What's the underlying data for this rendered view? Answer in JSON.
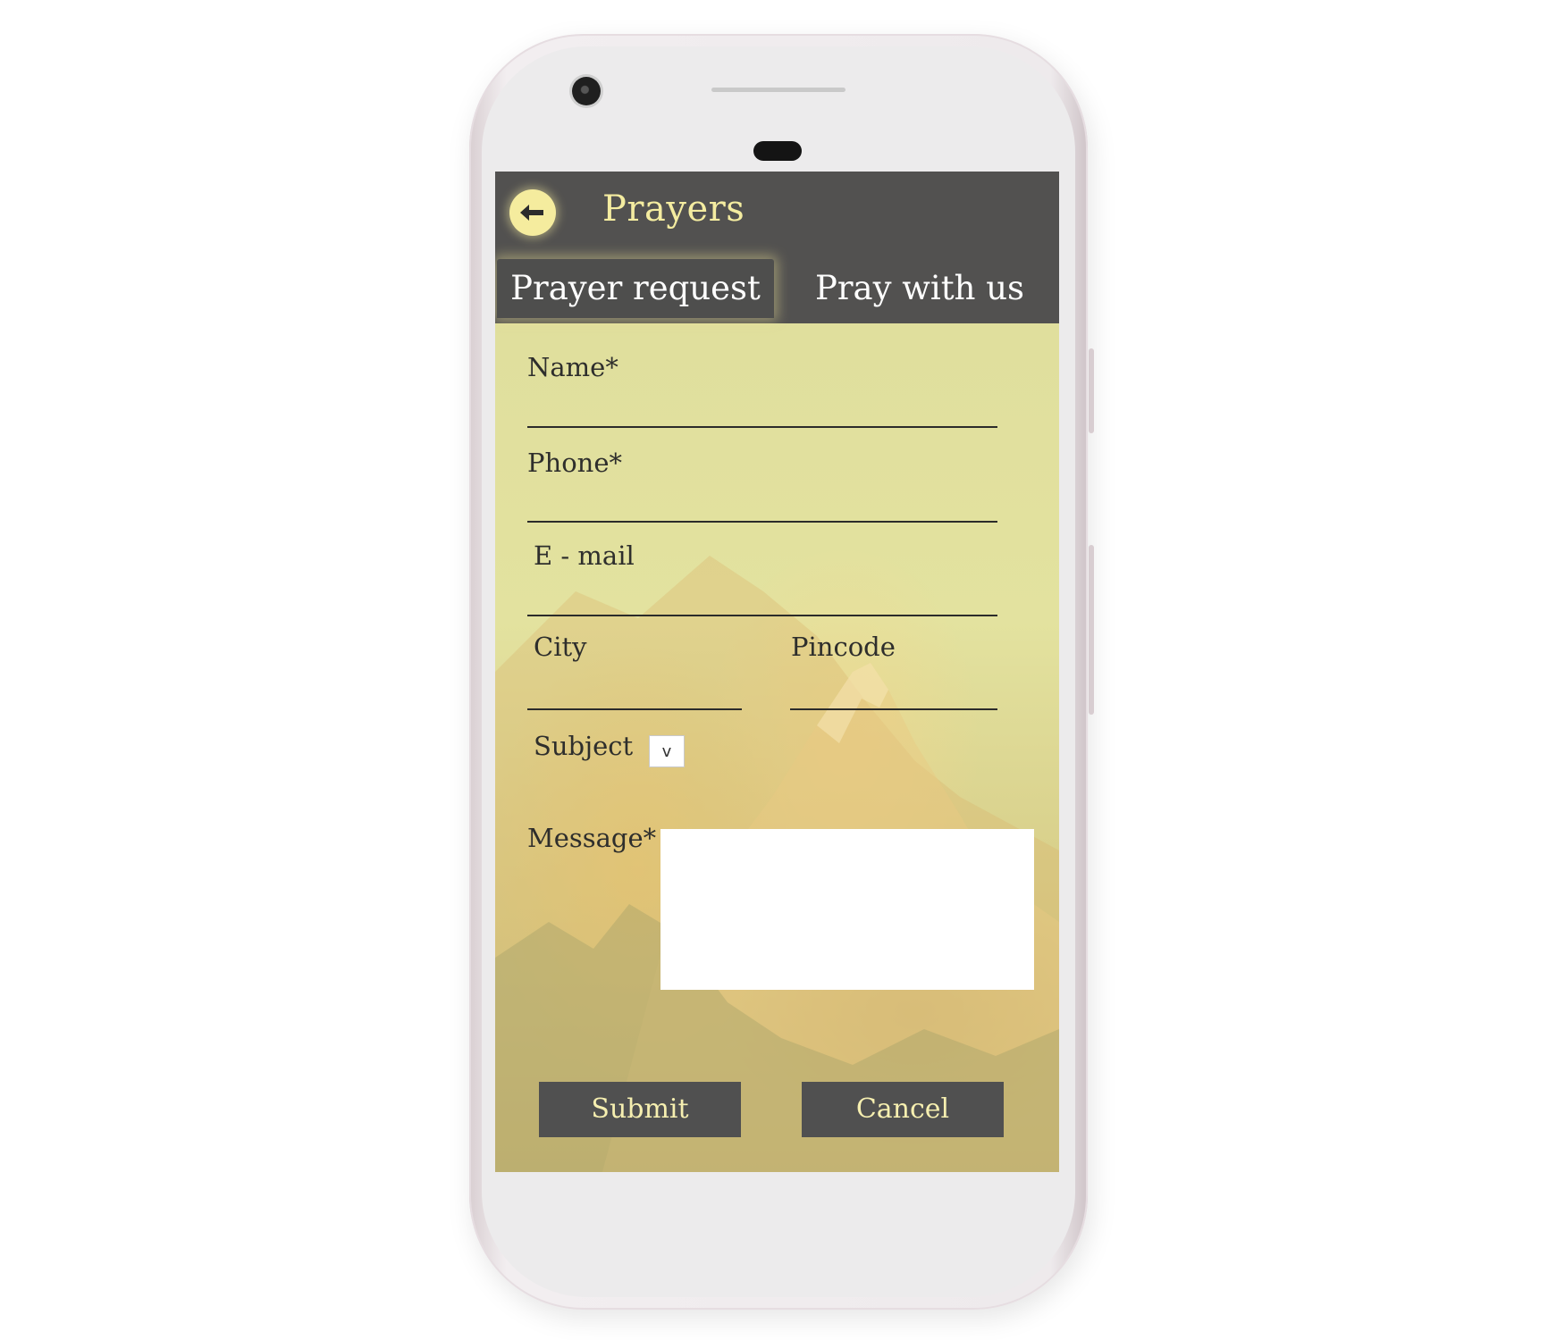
{
  "app": {
    "title": "Prayers",
    "back_icon": "arrow-left-icon"
  },
  "tabs": [
    {
      "label": "Prayer request",
      "active": true
    },
    {
      "label": "Pray with us",
      "active": false
    }
  ],
  "form": {
    "name_label": "Name*",
    "phone_label": "Phone*",
    "email_label": "E - mail",
    "city_label": "City",
    "pincode_label": "Pincode",
    "subject_label": "Subject",
    "subject_select_glyph": "v",
    "message_label": "Message*",
    "name_value": "",
    "phone_value": "",
    "email_value": "",
    "city_value": "",
    "pincode_value": "",
    "message_value": ""
  },
  "buttons": {
    "submit": "Submit",
    "cancel": "Cancel"
  },
  "colors": {
    "appbar": "#525150",
    "accent": "#f4eca0",
    "background": "#dedd9c",
    "button": "#505050"
  }
}
